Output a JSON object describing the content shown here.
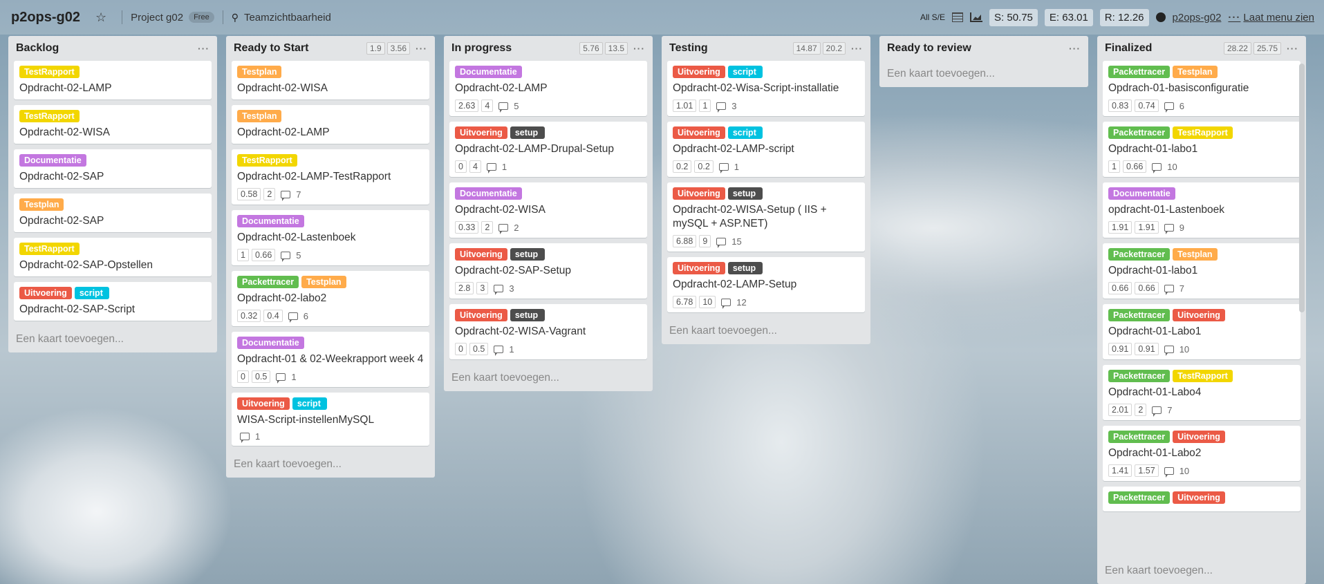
{
  "header": {
    "board_title": "p2ops-g02",
    "project": "Project g02",
    "plan_badge": "Free",
    "team_visibility": "Teamzichtbaarheid",
    "all_se": "All S/E",
    "stat_s": "S: 50.75",
    "stat_e": "E: 63.01",
    "stat_r": "R: 12.26",
    "github_link": "p2ops-g02",
    "show_menu": "Laat menu zien"
  },
  "colors": {
    "TestRapport": "#f2d600",
    "Testplan": "#ffab4a",
    "Documentatie": "#c377e0",
    "Uitvoering": "#eb5a46",
    "script": "#00c2e0",
    "setup": "#4d4d4d",
    "Packettracer": "#61bd4f"
  },
  "add_card_label": "Een kaart toevoegen...",
  "lists": [
    {
      "title": "Backlog",
      "chips": [],
      "cards": [
        {
          "labels": [
            "TestRapport"
          ],
          "title": "Opdracht-02-LAMP"
        },
        {
          "labels": [
            "TestRapport"
          ],
          "title": "Opdracht-02-WISA"
        },
        {
          "labels": [
            "Documentatie"
          ],
          "title": "Opdracht-02-SAP"
        },
        {
          "labels": [
            "Testplan"
          ],
          "title": "Opdracht-02-SAP"
        },
        {
          "labels": [
            "TestRapport"
          ],
          "title": "Opdracht-02-SAP-Opstellen"
        },
        {
          "labels": [
            "Uitvoering",
            "script"
          ],
          "title": "Opdracht-02-SAP-Script"
        }
      ]
    },
    {
      "title": "Ready to Start",
      "chips": [
        "1.9",
        "3.56"
      ],
      "cards": [
        {
          "labels": [
            "Testplan"
          ],
          "title": "Opdracht-02-WISA"
        },
        {
          "labels": [
            "Testplan"
          ],
          "title": "Opdracht-02-LAMP"
        },
        {
          "labels": [
            "TestRapport"
          ],
          "title": "Opdracht-02-LAMP-TestRapport",
          "s": "0.58",
          "e": "2",
          "comments": "7"
        },
        {
          "labels": [
            "Documentatie"
          ],
          "title": "Opdracht-02-Lastenboek",
          "s": "1",
          "e": "0.66",
          "comments": "5"
        },
        {
          "labels": [
            "Packettracer",
            "Testplan"
          ],
          "title": "Opdracht-02-labo2",
          "s": "0.32",
          "e": "0.4",
          "comments": "6"
        },
        {
          "labels": [
            "Documentatie"
          ],
          "title": "Opdracht-01 & 02-Weekrapport week 4",
          "s": "0",
          "e": "0.5",
          "comments": "1"
        },
        {
          "labels": [
            "Uitvoering",
            "script"
          ],
          "title": "WISA-Script-instellenMySQL",
          "comments": "1"
        }
      ]
    },
    {
      "title": "In progress",
      "chips": [
        "5.76",
        "13.5"
      ],
      "cards": [
        {
          "labels": [
            "Documentatie"
          ],
          "title": "Opdracht-02-LAMP",
          "s": "2.63",
          "e": "4",
          "comments": "5"
        },
        {
          "labels": [
            "Uitvoering",
            "setup"
          ],
          "title": "Opdracht-02-LAMP-Drupal-Setup",
          "s": "0",
          "e": "4",
          "comments": "1"
        },
        {
          "labels": [
            "Documentatie"
          ],
          "title": "Opdracht-02-WISA",
          "s": "0.33",
          "e": "2",
          "comments": "2"
        },
        {
          "labels": [
            "Uitvoering",
            "setup"
          ],
          "title": "Opdracht-02-SAP-Setup",
          "s": "2.8",
          "e": "3",
          "comments": "3"
        },
        {
          "labels": [
            "Uitvoering",
            "setup"
          ],
          "title": "Opdracht-02-WISA-Vagrant",
          "s": "0",
          "e": "0.5",
          "comments": "1"
        }
      ]
    },
    {
      "title": "Testing",
      "chips": [
        "14.87",
        "20.2"
      ],
      "cards": [
        {
          "labels": [
            "Uitvoering",
            "script"
          ],
          "title": "Opdracht-02-Wisa-Script-installatie",
          "s": "1.01",
          "e": "1",
          "comments": "3"
        },
        {
          "labels": [
            "Uitvoering",
            "script"
          ],
          "title": "Opdracht-02-LAMP-script",
          "s": "0.2",
          "e": "0.2",
          "comments": "1"
        },
        {
          "labels": [
            "Uitvoering",
            "setup"
          ],
          "title": "Opdracht-02-WISA-Setup ( IIS + mySQL + ASP.NET)",
          "s": "6.88",
          "e": "9",
          "comments": "15"
        },
        {
          "labels": [
            "Uitvoering",
            "setup"
          ],
          "title": "Opdracht-02-LAMP-Setup",
          "s": "6.78",
          "e": "10",
          "comments": "12"
        }
      ]
    },
    {
      "title": "Ready to review",
      "chips": [],
      "cards": []
    },
    {
      "title": "Finalized",
      "chips": [
        "28.22",
        "25.75"
      ],
      "cards": [
        {
          "labels": [
            "Packettracer",
            "Testplan"
          ],
          "title": "Opdrach-01-basisconfiguratie",
          "s": "0.83",
          "e": "0.74",
          "comments": "6"
        },
        {
          "labels": [
            "Packettracer",
            "TestRapport"
          ],
          "title": "Opdracht-01-labo1",
          "s": "1",
          "e": "0.66",
          "comments": "10"
        },
        {
          "labels": [
            "Documentatie"
          ],
          "title": "opdracht-01-Lastenboek",
          "s": "1.91",
          "e": "1.91",
          "comments": "9"
        },
        {
          "labels": [
            "Packettracer",
            "Testplan"
          ],
          "title": "Opdracht-01-labo1",
          "s": "0.66",
          "e": "0.66",
          "comments": "7"
        },
        {
          "labels": [
            "Packettracer",
            "Uitvoering"
          ],
          "title": "Opdracht-01-Labo1",
          "s": "0.91",
          "e": "0.91",
          "comments": "10"
        },
        {
          "labels": [
            "Packettracer",
            "TestRapport"
          ],
          "title": "Opdracht-01-Labo4",
          "s": "2.01",
          "e": "2",
          "comments": "7"
        },
        {
          "labels": [
            "Packettracer",
            "Uitvoering"
          ],
          "title": "Opdracht-01-Labo2",
          "s": "1.41",
          "e": "1.57",
          "comments": "10"
        },
        {
          "labels": [
            "Packettracer",
            "Uitvoering"
          ],
          "title": ""
        }
      ]
    }
  ]
}
